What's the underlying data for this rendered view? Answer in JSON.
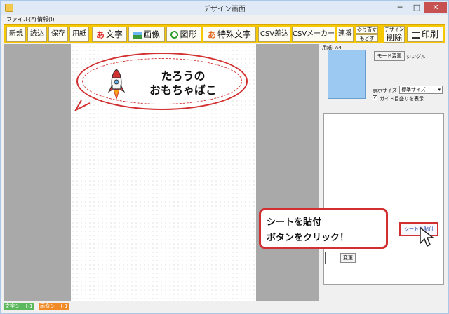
{
  "window": {
    "title": "デザイン画面",
    "min": "─",
    "max": "□",
    "close": "✕"
  },
  "menu": [
    "ファイル(F)",
    "情報(I)"
  ],
  "toolbar": {
    "new": "新規",
    "open": "読込",
    "save": "保存",
    "paper": "用紙",
    "text": "文字",
    "image": "画像",
    "shape": "図形",
    "special_text": "特殊文字",
    "csv_insert": "CSV差込",
    "csv_maker": "CSVメーカー",
    "serial": "連番",
    "redo": "やり直す",
    "undo": "もどす",
    "delete_small": "デザイン",
    "delete": "削除",
    "print": "印刷",
    "text_icon": "あ",
    "special_icon": "あ"
  },
  "canvas": {
    "label_line1": "たろうの",
    "label_line2": "おもちゃばこ"
  },
  "panel": {
    "paper_label": "用紙: A4",
    "mode_button": "モード変更",
    "mode_value": "シングル",
    "display_size_label": "表示サイズ",
    "display_size_value": "標準サイズ",
    "guide_checkbox": "ガイド目盛りを表示",
    "guide_checked": "✓",
    "paste_sheet_button": "シートを貼付",
    "change_button": "変更"
  },
  "callout": {
    "line1": "シートを貼付",
    "line2": "ボタンをクリック！"
  },
  "status_tabs": [
    {
      "label": "文字シート1",
      "color": "#5cb85c"
    },
    {
      "label": "画像シート1",
      "color": "#f08a24"
    }
  ],
  "colors": {
    "toolbar": "#f7c800",
    "accent_red": "#d23030",
    "preview_blue": "#9cc9f2"
  }
}
